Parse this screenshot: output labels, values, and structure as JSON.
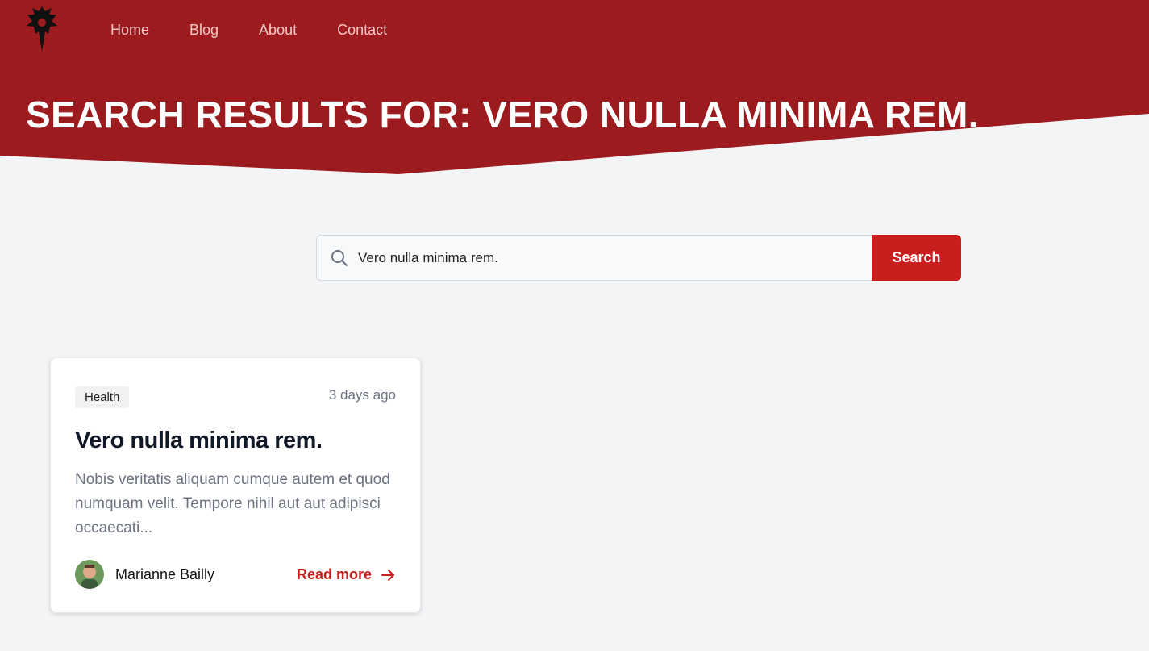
{
  "colors": {
    "brand": "#9b1b1e",
    "accent": "#c81e1e",
    "background": "#f3f4f6"
  },
  "header": {
    "logo_icon": "horde-emblem-icon",
    "nav": [
      {
        "label": "Home"
      },
      {
        "label": "Blog"
      },
      {
        "label": "About"
      },
      {
        "label": "Contact"
      }
    ],
    "page_title": "SEARCH RESULTS FOR: VERO NULLA MINIMA REM."
  },
  "search": {
    "icon": "search-icon",
    "value": "Vero nulla minima rem.",
    "button_label": "Search"
  },
  "results": [
    {
      "category": "Health",
      "date": "3 days ago",
      "title": "Vero nulla minima rem.",
      "excerpt": "Nobis veritatis aliquam cumque autem et quod numquam velit. Tempore nihil aut aut adipisci occaecati...",
      "author": "Marianne Bailly",
      "read_more": "Read more",
      "read_more_icon": "arrow-right-icon"
    }
  ]
}
